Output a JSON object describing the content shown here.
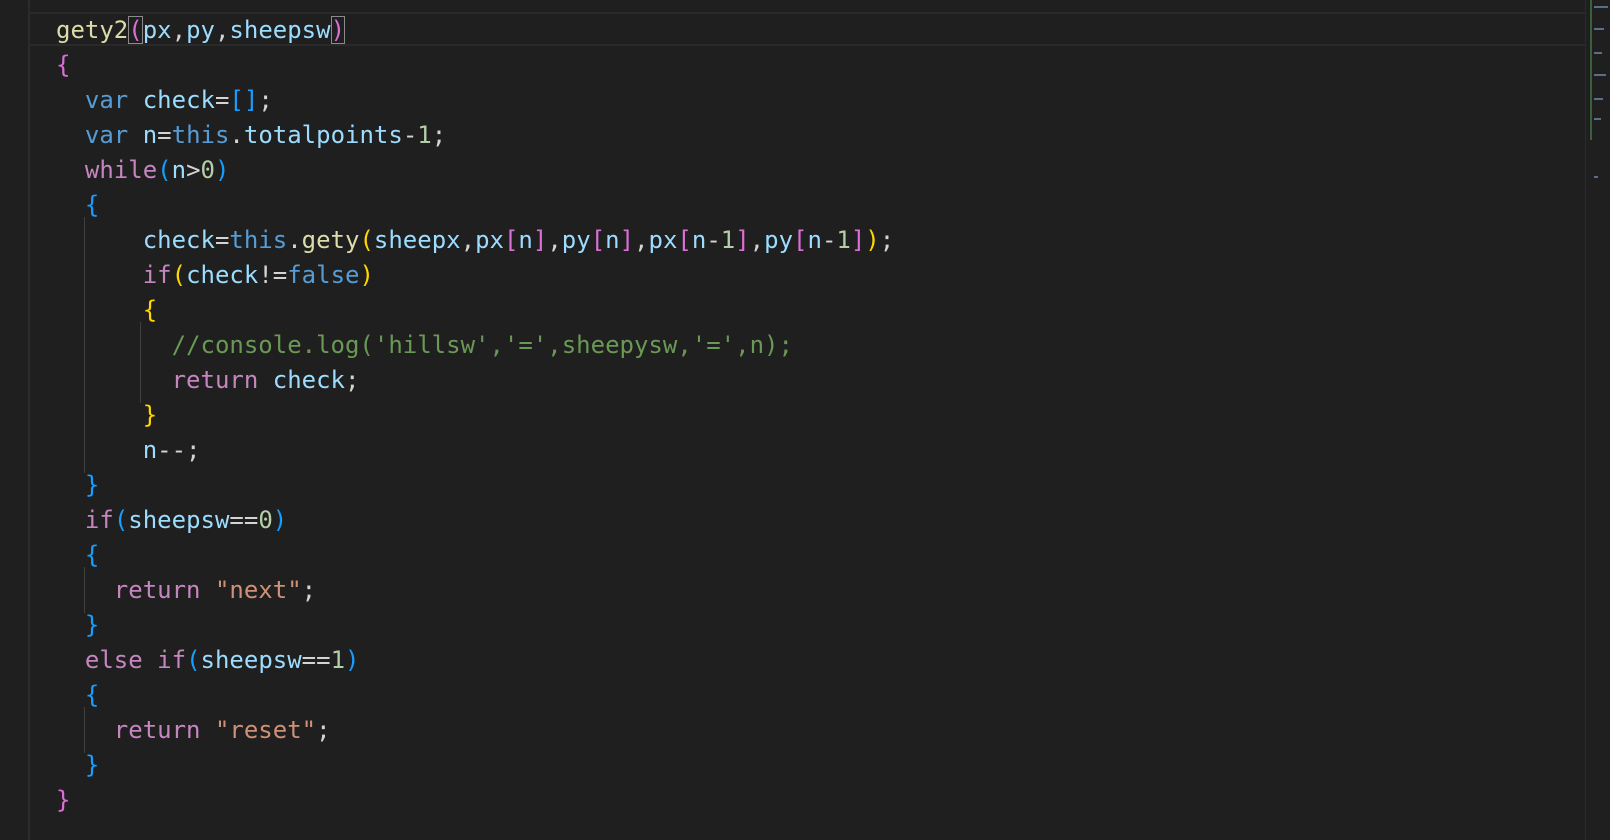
{
  "theme": {
    "background": "#1f1f1f",
    "default_text": "#d4d4d4",
    "keyword_blue": "#569cd6",
    "control_purple": "#c586c0",
    "function_yellow": "#dcdcaa",
    "variable_lightblue": "#9cdcfe",
    "number_green": "#b5cea8",
    "string_orange": "#ce9178",
    "comment_green": "#6a9955",
    "bracket_gold": "#ffd700",
    "bracket_magenta": "#da70d6",
    "bracket_blue": "#179fff"
  },
  "code_lines": [
    [
      {
        "t": "gety2",
        "c": "#dcdcaa"
      },
      {
        "t": "(",
        "c": "#da70d6",
        "box": true
      },
      {
        "t": "px",
        "c": "#9cdcfe"
      },
      {
        "t": ",",
        "c": "#d4d4d4"
      },
      {
        "t": "py",
        "c": "#9cdcfe"
      },
      {
        "t": ",",
        "c": "#d4d4d4"
      },
      {
        "t": "sheepsw",
        "c": "#9cdcfe"
      },
      {
        "t": ")",
        "c": "#da70d6",
        "box": true
      }
    ],
    [
      {
        "t": "{",
        "c": "#da70d6"
      }
    ],
    [
      {
        "t": "  "
      },
      {
        "t": "var",
        "c": "#569cd6"
      },
      {
        "t": " "
      },
      {
        "t": "check",
        "c": "#9cdcfe"
      },
      {
        "t": "=",
        "c": "#d4d4d4"
      },
      {
        "t": "[]",
        "c": "#179fff"
      },
      {
        "t": ";",
        "c": "#d4d4d4"
      }
    ],
    [
      {
        "t": "  "
      },
      {
        "t": "var",
        "c": "#569cd6"
      },
      {
        "t": " "
      },
      {
        "t": "n",
        "c": "#9cdcfe"
      },
      {
        "t": "=",
        "c": "#d4d4d4"
      },
      {
        "t": "this",
        "c": "#569cd6"
      },
      {
        "t": ".",
        "c": "#d4d4d4"
      },
      {
        "t": "totalpoints",
        "c": "#9cdcfe"
      },
      {
        "t": "-",
        "c": "#d4d4d4"
      },
      {
        "t": "1",
        "c": "#b5cea8"
      },
      {
        "t": ";",
        "c": "#d4d4d4"
      }
    ],
    [
      {
        "t": "  "
      },
      {
        "t": "while",
        "c": "#c586c0"
      },
      {
        "t": "(",
        "c": "#179fff"
      },
      {
        "t": "n",
        "c": "#9cdcfe"
      },
      {
        "t": ">",
        "c": "#d4d4d4"
      },
      {
        "t": "0",
        "c": "#b5cea8"
      },
      {
        "t": ")",
        "c": "#179fff"
      }
    ],
    [
      {
        "t": "  "
      },
      {
        "t": "{",
        "c": "#179fff"
      }
    ],
    [
      {
        "t": "      "
      },
      {
        "t": "check",
        "c": "#9cdcfe"
      },
      {
        "t": "=",
        "c": "#d4d4d4"
      },
      {
        "t": "this",
        "c": "#569cd6"
      },
      {
        "t": ".",
        "c": "#d4d4d4"
      },
      {
        "t": "gety",
        "c": "#dcdcaa"
      },
      {
        "t": "(",
        "c": "#ffd700"
      },
      {
        "t": "sheepx",
        "c": "#9cdcfe"
      },
      {
        "t": ",",
        "c": "#d4d4d4"
      },
      {
        "t": "px",
        "c": "#9cdcfe"
      },
      {
        "t": "[",
        "c": "#da70d6"
      },
      {
        "t": "n",
        "c": "#9cdcfe"
      },
      {
        "t": "]",
        "c": "#da70d6"
      },
      {
        "t": ",",
        "c": "#d4d4d4"
      },
      {
        "t": "py",
        "c": "#9cdcfe"
      },
      {
        "t": "[",
        "c": "#da70d6"
      },
      {
        "t": "n",
        "c": "#9cdcfe"
      },
      {
        "t": "]",
        "c": "#da70d6"
      },
      {
        "t": ",",
        "c": "#d4d4d4"
      },
      {
        "t": "px",
        "c": "#9cdcfe"
      },
      {
        "t": "[",
        "c": "#da70d6"
      },
      {
        "t": "n",
        "c": "#9cdcfe"
      },
      {
        "t": "-",
        "c": "#d4d4d4"
      },
      {
        "t": "1",
        "c": "#b5cea8"
      },
      {
        "t": "]",
        "c": "#da70d6"
      },
      {
        "t": ",",
        "c": "#d4d4d4"
      },
      {
        "t": "py",
        "c": "#9cdcfe"
      },
      {
        "t": "[",
        "c": "#da70d6"
      },
      {
        "t": "n",
        "c": "#9cdcfe"
      },
      {
        "t": "-",
        "c": "#d4d4d4"
      },
      {
        "t": "1",
        "c": "#b5cea8"
      },
      {
        "t": "]",
        "c": "#da70d6"
      },
      {
        "t": ")",
        "c": "#ffd700"
      },
      {
        "t": ";",
        "c": "#d4d4d4"
      }
    ],
    [
      {
        "t": "      "
      },
      {
        "t": "if",
        "c": "#c586c0"
      },
      {
        "t": "(",
        "c": "#ffd700"
      },
      {
        "t": "check",
        "c": "#9cdcfe"
      },
      {
        "t": "!=",
        "c": "#d4d4d4"
      },
      {
        "t": "false",
        "c": "#569cd6"
      },
      {
        "t": ")",
        "c": "#ffd700"
      }
    ],
    [
      {
        "t": "      "
      },
      {
        "t": "{",
        "c": "#ffd700"
      }
    ],
    [
      {
        "t": "        "
      },
      {
        "t": "//console.log('hillsw','=',sheepysw,'=',n);",
        "c": "#6a9955"
      }
    ],
    [
      {
        "t": "        "
      },
      {
        "t": "return",
        "c": "#c586c0"
      },
      {
        "t": " "
      },
      {
        "t": "check",
        "c": "#9cdcfe"
      },
      {
        "t": ";",
        "c": "#d4d4d4"
      }
    ],
    [
      {
        "t": "      "
      },
      {
        "t": "}",
        "c": "#ffd700"
      }
    ],
    [
      {
        "t": "      "
      },
      {
        "t": "n",
        "c": "#9cdcfe"
      },
      {
        "t": "--;",
        "c": "#d4d4d4"
      }
    ],
    [
      {
        "t": "  "
      },
      {
        "t": "}",
        "c": "#179fff"
      }
    ],
    [
      {
        "t": "  "
      },
      {
        "t": "if",
        "c": "#c586c0"
      },
      {
        "t": "(",
        "c": "#179fff"
      },
      {
        "t": "sheepsw",
        "c": "#9cdcfe"
      },
      {
        "t": "==",
        "c": "#d4d4d4"
      },
      {
        "t": "0",
        "c": "#b5cea8"
      },
      {
        "t": ")",
        "c": "#179fff"
      }
    ],
    [
      {
        "t": "  "
      },
      {
        "t": "{",
        "c": "#179fff"
      }
    ],
    [
      {
        "t": "    "
      },
      {
        "t": "return",
        "c": "#c586c0"
      },
      {
        "t": " "
      },
      {
        "t": "\"next\"",
        "c": "#ce9178"
      },
      {
        "t": ";",
        "c": "#d4d4d4"
      }
    ],
    [
      {
        "t": "  "
      },
      {
        "t": "}",
        "c": "#179fff"
      }
    ],
    [
      {
        "t": "  "
      },
      {
        "t": "else",
        "c": "#c586c0"
      },
      {
        "t": " "
      },
      {
        "t": "if",
        "c": "#c586c0"
      },
      {
        "t": "(",
        "c": "#179fff"
      },
      {
        "t": "sheepsw",
        "c": "#9cdcfe"
      },
      {
        "t": "==",
        "c": "#d4d4d4"
      },
      {
        "t": "1",
        "c": "#b5cea8"
      },
      {
        "t": ")",
        "c": "#179fff"
      }
    ],
    [
      {
        "t": "  "
      },
      {
        "t": "{",
        "c": "#179fff"
      }
    ],
    [
      {
        "t": "    "
      },
      {
        "t": "return",
        "c": "#c586c0"
      },
      {
        "t": " "
      },
      {
        "t": "\"reset\"",
        "c": "#ce9178"
      },
      {
        "t": ";",
        "c": "#d4d4d4"
      }
    ],
    [
      {
        "t": "  "
      },
      {
        "t": "}",
        "c": "#179fff"
      }
    ],
    [
      {
        "t": "}",
        "c": "#da70d6"
      }
    ]
  ]
}
